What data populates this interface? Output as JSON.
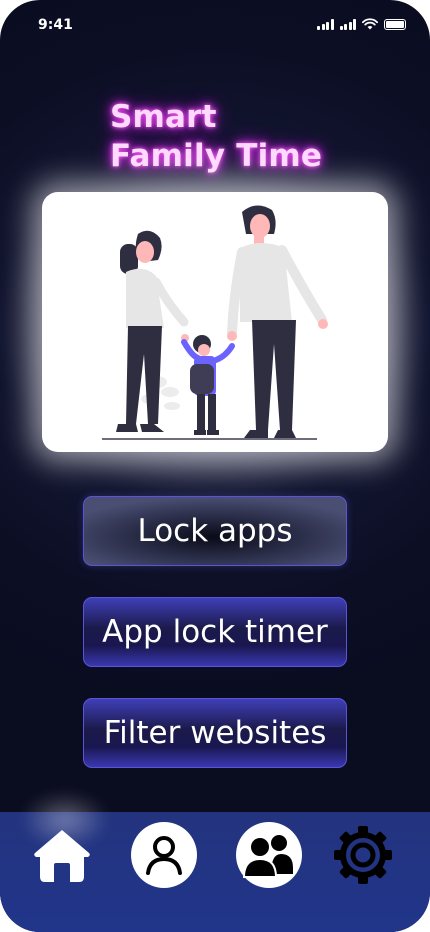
{
  "status_bar": {
    "time": "9:41"
  },
  "app": {
    "title_line1": "Smart",
    "title_line2": "Family Time"
  },
  "illustration": {
    "icon": "family-illustration"
  },
  "buttons": {
    "lock_apps": "Lock apps",
    "app_lock_timer": "App lock timer",
    "filter_websites": "Filter websites"
  },
  "nav": {
    "items": [
      {
        "icon": "home-icon"
      },
      {
        "icon": "user-icon"
      },
      {
        "icon": "family-group-icon"
      },
      {
        "icon": "gear-icon"
      }
    ]
  },
  "colors": {
    "background": "#0c0e24",
    "title_glow": "#e040fb",
    "button_border": "#5a55d8",
    "nav_background": "#23337e",
    "child_shirt": "#6c63ff"
  }
}
